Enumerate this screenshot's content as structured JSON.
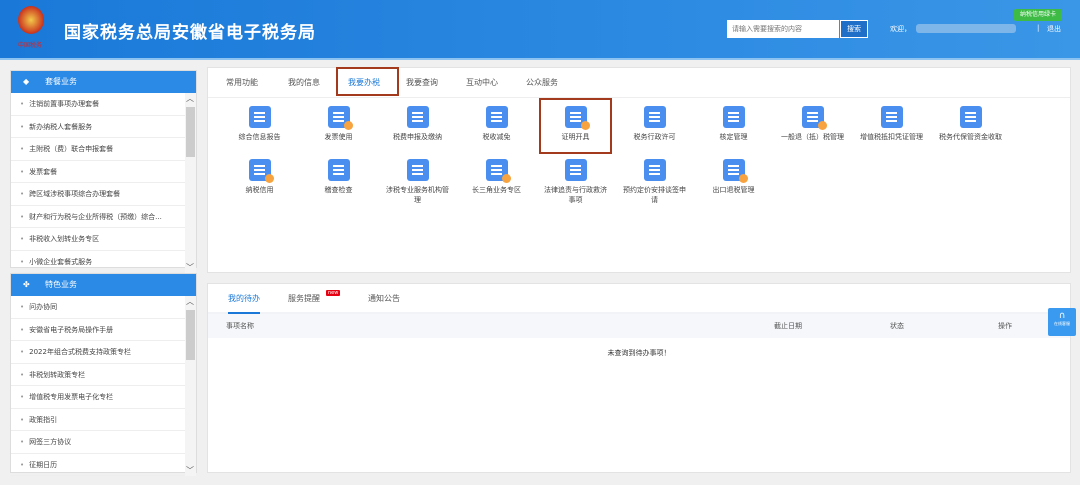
{
  "header": {
    "title": "国家税务总局安徽省电子税务局",
    "logo_text": "中国税务",
    "search_placeholder": "请输入需要搜索的内容",
    "search_button": "搜索",
    "welcome": "欢迎，",
    "separator": "|",
    "logout": "退出",
    "credit_badge": "纳税信用绿卡"
  },
  "sidebar": {
    "section1": {
      "title": "套餐业务",
      "items": [
        "注销前置事项办理套餐",
        "新办纳税人套餐服务",
        "主附税（费）联合申报套餐",
        "发票套餐",
        "跨区域涉税事项综合办理套餐",
        "财产和行为税与企业所得税（预缴）综合...",
        "非税收入划转业务专区",
        "小微企业套餐式服务"
      ]
    },
    "section2": {
      "title": "特色业务",
      "items": [
        "问办协同",
        "安徽省电子税务局操作手册",
        "2022年组合式税费支持政策专栏",
        "非税划转政策专栏",
        "增值税专用发票电子化专栏",
        "政策指引",
        "网签三方协议",
        "征期日历"
      ]
    }
  },
  "main": {
    "tabs": [
      "常用功能",
      "我的信息",
      "我要办税",
      "我要查询",
      "互动中心",
      "公众服务"
    ],
    "active_tab": "我要办税",
    "functions": [
      {
        "label": "综合信息报告"
      },
      {
        "label": "发票使用"
      },
      {
        "label": "税费申报及缴纳"
      },
      {
        "label": "税收减免"
      },
      {
        "label": "证明开具"
      },
      {
        "label": "税务行政许可"
      },
      {
        "label": "核定管理"
      },
      {
        "label": "一般退（抵）税管理"
      },
      {
        "label": "增值税抵扣凭证管理"
      },
      {
        "label": "税务代保管资金收取"
      },
      {
        "label": "纳税信用"
      },
      {
        "label": "稽查检查"
      },
      {
        "label": "涉税专业服务机构管理"
      },
      {
        "label": "长三角业务专区"
      },
      {
        "label": "法律追责与行政救济事项"
      },
      {
        "label": "预约定价安排谈签申请"
      },
      {
        "label": "出口退税管理"
      }
    ]
  },
  "todo": {
    "tabs": [
      "我的待办",
      "服务提醒",
      "通知公告"
    ],
    "new_badge": "new",
    "columns": [
      "事项名称",
      "截止日期",
      "状态",
      "操作"
    ],
    "empty_message": "未查询到待办事项！"
  },
  "float_button": "在线客服",
  "colors": {
    "primary": "#1a78d8",
    "highlight": "#a33a1e",
    "new": "#e60012"
  }
}
